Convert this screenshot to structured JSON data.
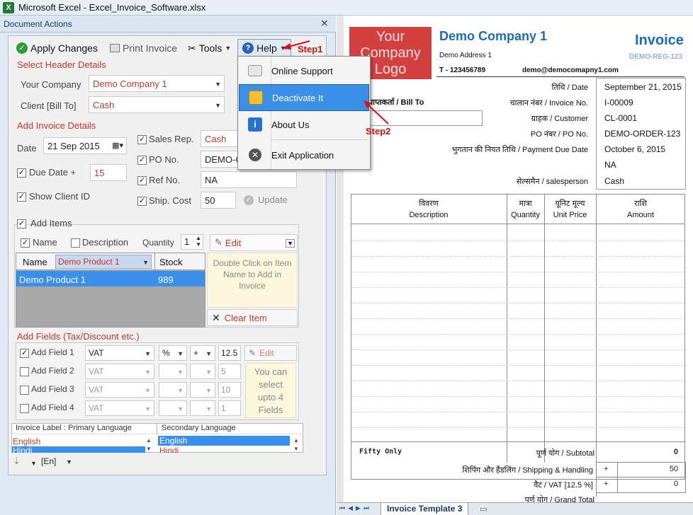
{
  "window": {
    "title": "Microsoft Excel - Excel_Invoice_Software.xlsx"
  },
  "pane": {
    "title": "Document Actions",
    "toolbar": {
      "apply": "Apply Changes",
      "print": "Print Invoice",
      "tools": "Tools",
      "help": "Help"
    },
    "header_section": {
      "title": "Select Header Details",
      "company_label": "Your Company",
      "company_value": "Demo Company 1",
      "client_label": "Client [Bill To]",
      "client_value": "Cash"
    },
    "invoice_section": {
      "title": "Add Invoice Details",
      "date_label": "Date",
      "date_value": "21 Sep 2015",
      "due_label": "Due Date +",
      "due_value": "15",
      "show_client_label": "Show Client ID",
      "sales_label": "Sales Rep.",
      "sales_value": "Cash",
      "po_label": "PO No.",
      "po_value": "DEMO-OI",
      "ref_label": "Ref No.",
      "ref_value": "NA",
      "ship_label": "Ship. Cost",
      "ship_value": "50",
      "update": "Update"
    },
    "items_section": {
      "title": "Add Items",
      "name_chk": "Name",
      "desc_chk": "Description",
      "qty_label": "Quantity",
      "qty_value": "1",
      "edit": "Edit",
      "col_name": "Name",
      "col_filter": "Demo Product 1",
      "col_stock": "Stock",
      "rows": [
        {
          "name": "Demo Product 1",
          "stock": "989"
        }
      ],
      "hint": "Double Click on Item Name to Add in Invoice",
      "clear": "Clear Item"
    },
    "fields_section": {
      "title": "Add Fields (Tax/Discount etc.)",
      "fields": [
        {
          "label": "Add Field 1",
          "type": "VAT",
          "unit": "%",
          "sign": "+",
          "value": "12.5"
        },
        {
          "label": "Add Field 2",
          "type": "VAT",
          "unit": "",
          "sign": "",
          "value": "5"
        },
        {
          "label": "Add Field 3",
          "type": "VAT",
          "unit": "",
          "sign": "",
          "value": "10"
        },
        {
          "label": "Add Field 4",
          "type": "VAT",
          "unit": "",
          "sign": "",
          "value": "1"
        }
      ],
      "edit": "Edit",
      "hint": "You can select upto 4 Fields"
    },
    "language_section": {
      "primary_label": "Invoice Label : Primary Language",
      "secondary_label": "Secondary Language",
      "primary_items": [
        "English",
        "Hindi"
      ],
      "secondary_items": [
        "English",
        "Hindi"
      ],
      "lang_code": "[En]"
    }
  },
  "help_menu": {
    "items": [
      {
        "label": "Online Support",
        "icon": "support-icon"
      },
      {
        "label": "Deactivate It",
        "icon": "lock-icon"
      },
      {
        "label": "About Us",
        "icon": "info-icon"
      },
      {
        "label": "Exit Application",
        "icon": "exit-icon"
      }
    ],
    "step1": "Step1",
    "step2": "Step2"
  },
  "invoice": {
    "logo_text": "Your Company Logo",
    "company": "Demo Company 1",
    "address": "Demo Address 1",
    "phone": "T - 123456789",
    "email": "demo@democomapny1.com",
    "title": "Invoice",
    "reg": "DEMO-REG-123",
    "bill_to": "प्राप्तकर्ता / Bill To",
    "meta": [
      {
        "label": "तिथि / Date",
        "value": "September 21, 2015"
      },
      {
        "label": "चालान नंबर / Invoice No.",
        "value": "I-00009"
      },
      {
        "label": "ग्राहक / Customer",
        "value": "CL-0001"
      },
      {
        "label": "PO नंबर / PO No.",
        "value": "DEMO-ORDER-123"
      },
      {
        "label": "भुगतान की नियत तिथि / Payment Due Date",
        "value": "October 6, 2015"
      },
      {
        "label": "",
        "value": "NA"
      },
      {
        "label": "सेल्समैन / salesperson",
        "value": "Cash"
      }
    ],
    "columns": [
      {
        "hi": "विवरण",
        "en": "Description"
      },
      {
        "hi": "मात्रा",
        "en": "Quantity"
      },
      {
        "hi": "यूनिट मूल्य",
        "en": "Unit Price"
      },
      {
        "hi": "राशि",
        "en": "Amount"
      }
    ],
    "words": "Fifty Only",
    "subtotal_label": "पूर्ण योग / Subtotal",
    "subtotal_value": "0",
    "shipping_label": "शिपिंग और हैंडलिंग / Shipping & Handling",
    "shipping_sign": "+",
    "shipping_value": "50",
    "vat_label": "वैट / VAT [12.5 %]",
    "vat_sign": "+",
    "vat_value": "0",
    "grand_label": "पूर्ण योग / Grand Total"
  },
  "sheet_tab": "Invoice Template 3"
}
